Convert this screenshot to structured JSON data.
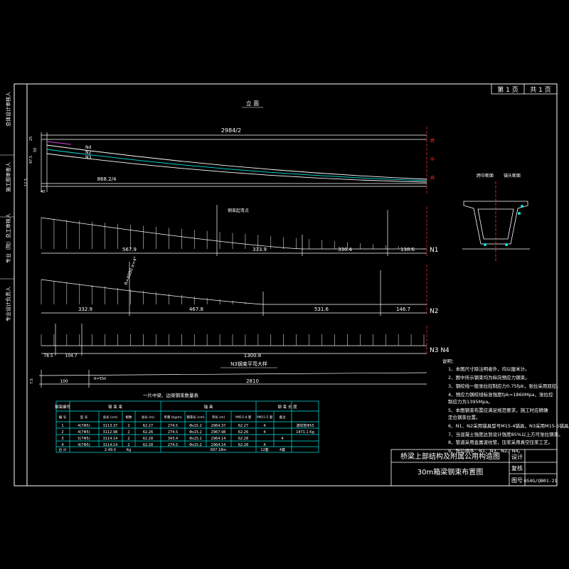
{
  "title_block": {
    "page_no": "第 1 页",
    "total": "共 1 页",
    "project": "桥梁上部结构及附属公用构造图",
    "drawing_title": "30m箱梁钢束布置图",
    "design": "设计",
    "review": "复核",
    "fig_no_label": "图号",
    "fig_no": "GS4G/QB01-21"
  },
  "left_strip": [
    "总体设计审核人",
    "施工图审查人",
    "专业（院）总工审核人",
    "专业设计负责人"
  ],
  "elevation": {
    "title": "立 面",
    "total_dim": "2984/2",
    "bottom_dim": "868.2/4",
    "left_dims": [
      "25",
      "12.5",
      "97.5",
      "50",
      "40"
    ],
    "beam_labels": [
      "Nd",
      "N2",
      "N3"
    ],
    "right_marks": [
      "跨",
      "中",
      "线"
    ]
  },
  "profile_n1": {
    "label": "N1",
    "note": "钢束起弯点",
    "segments": [
      "567.9",
      "333.9",
      "336.4",
      "138.6"
    ]
  },
  "profile_n2": {
    "label": "N2",
    "note": "R=4000 α=4°",
    "segments": [
      "332.9",
      "467.8",
      "531.6",
      "146.7"
    ]
  },
  "profile_n3": {
    "label": "N3 N4",
    "segments": [
      "78.5",
      "104.7",
      "1300.8"
    ],
    "caption": "N3钢束平弯大样"
  },
  "plan_strip": {
    "dims": [
      "100",
      "2810",
      "R=550",
      "7.5"
    ]
  },
  "sections": {
    "mid": "跨中断面",
    "end": "锚头断面"
  },
  "notes": {
    "heading": "说明：",
    "items": [
      "1、本图尺寸除注明者外，均以厘米计。",
      "2、图中所示钢束均为纵向预应力钢束。",
      "3、钢绞线一般张拉控制应力0.75fpk，张拉采用双控。",
      "4、预应力钢绞线标准强度fpk=1860Mpa，张拉控",
      "   制应力为1395Mpa。",
      "5、本图钢束布置应满足规范要求，施工时应精确",
      "   定位钢束位置。",
      "6、N1、N2采用锚具型号M15-4锚具，N3采用M15-5锚具。",
      "7、当混凝土强度达到设计强度85%以上方可张拉钢束。",
      "8、管道采用金属波纹管，压浆采用真空压浆工艺。",
      "9、张拉顺序：N1、N3、N2、N4。"
    ]
  },
  "table": {
    "title": "一片中梁、边梁钢束数量表",
    "header_groups": [
      "钢束编号",
      "钢 束 束",
      "锚 具",
      "钢 束 长 度"
    ],
    "headers": [
      "编 号",
      "型 号",
      "总长 (cm)",
      "根数",
      "总长 (m)",
      "单重 (kg/m)",
      "钢束长 (cm)",
      "单长 (m)",
      "YM15-4 套",
      "YM15-5 套",
      "备注"
    ],
    "rows": [
      [
        "1",
        "4(7Φ5)",
        "3113.37",
        "2",
        "62.27",
        "274.5",
        "Φs15.2",
        "2964.37",
        "62.27",
        "4",
        "",
        "波纹管Φ55"
      ],
      [
        "2",
        "4(7Φ5)",
        "3112.98",
        "2",
        "62.26",
        "274.5",
        "Φs15.2",
        "2967.98",
        "62.26",
        "4",
        "",
        "1471.1 Kg"
      ],
      [
        "3",
        "5(7Φ5)",
        "3114.14",
        "2",
        "62.28",
        "343.4",
        "Φs15.2",
        "2964.14",
        "62.28",
        "",
        "4",
        ""
      ],
      [
        "4",
        "4(7Φ5)",
        "3114.14",
        "2",
        "62.28",
        "274.5",
        "Φs15.2",
        "2964.14",
        "62.28",
        "4",
        "",
        ""
      ]
    ],
    "total_row": [
      "合 计",
      "",
      "2.49.0",
      "Kg",
      "",
      "",
      "",
      "697.18m",
      "",
      "12套",
      "4套",
      ""
    ]
  }
}
